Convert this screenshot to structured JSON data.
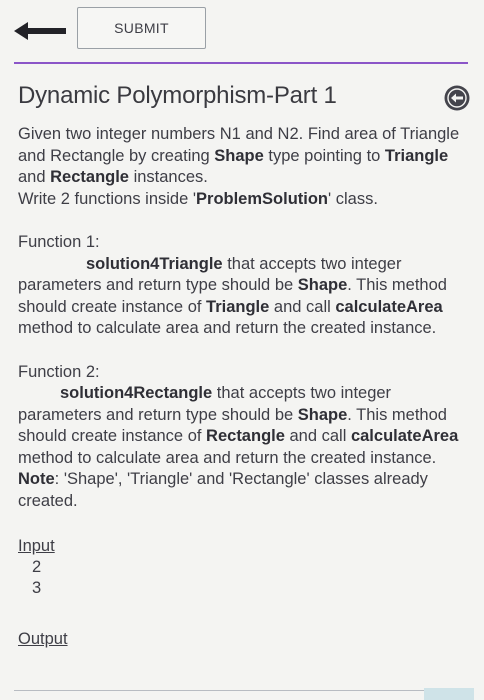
{
  "toolbar": {
    "back_icon": "arrow-left-icon",
    "submit_label": "SUBMIT"
  },
  "accent_color": "#8b55c8",
  "problem": {
    "title": "Dynamic Polymorphism-Part 1",
    "collapse_icon": "circle-arrow-left-icon",
    "intro": {
      "t1": "Given two integer numbers N1 and N2. Find area of Triangle and Rectangle by creating ",
      "b1": "Shape",
      "t2": " type pointing to ",
      "b2": "Triangle",
      "t3": " and ",
      "b3": "Rectangle",
      "t4": " instances."
    },
    "write": {
      "t1": "Write 2 functions  inside '",
      "b1": "ProblemSolution",
      "t2": "' class."
    },
    "function1": {
      "heading": "Function 1:",
      "b1": "solution4Triangle",
      "t1": " that accepts two integer parameters and return type should be ",
      "b2": "Shape",
      "t2": ". This method should create instance of ",
      "b3": "Triangle",
      "t3": " and call ",
      "b4": "calculateArea",
      "t4": " method to calculate area and return the created instance."
    },
    "function2": {
      "heading": "Function 2:",
      "b1": "solution4Rectangle",
      "t1": " that accepts two integer parameters and return type should be ",
      "b2": "Shape",
      "t2": ". This method should create instance of ",
      "b3": "Rectangle",
      "t3": " and call ",
      "b4": "calculateArea",
      "t4": " method to calculate area and return the created instance."
    },
    "note": {
      "label": "Note",
      "text": ": 'Shape', 'Triangle' and 'Rectangle' classes already created."
    },
    "input": {
      "label": "Input",
      "values": [
        "2",
        "3"
      ]
    },
    "output": {
      "label": "Output"
    }
  }
}
